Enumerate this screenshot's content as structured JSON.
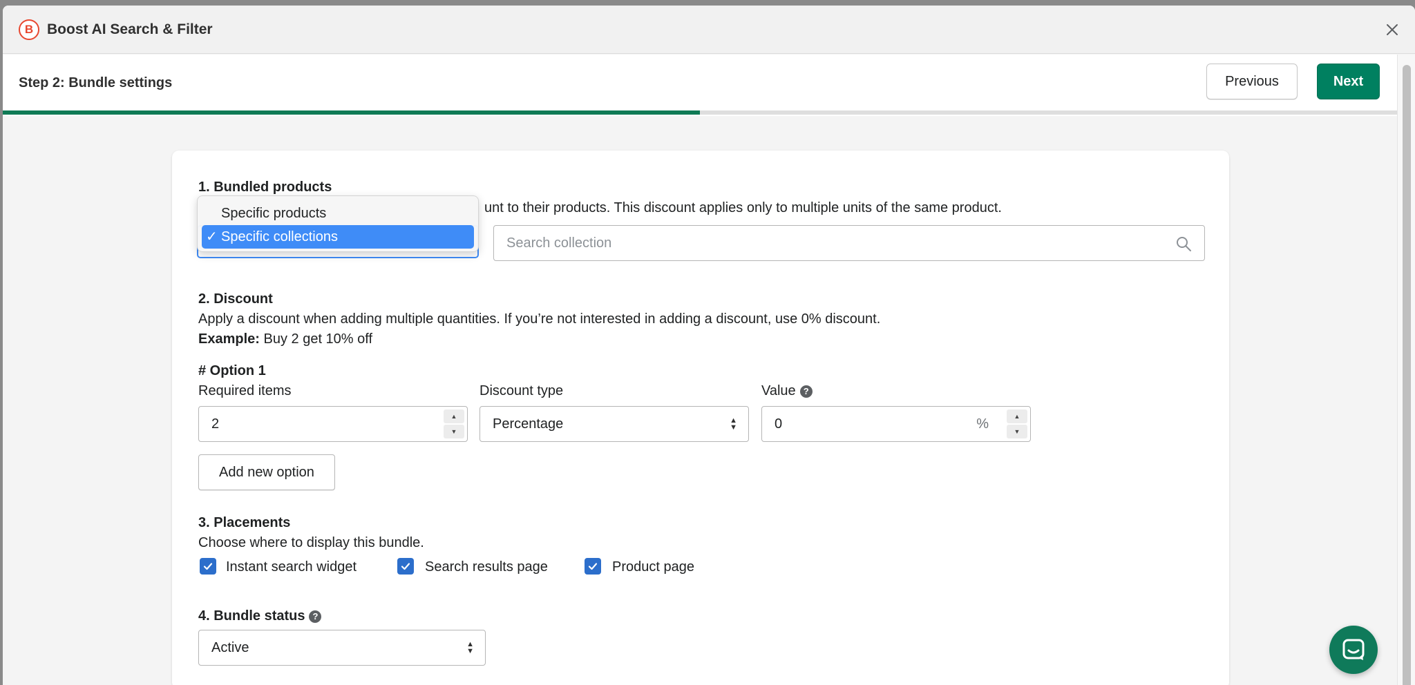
{
  "app": {
    "title": "Boost AI Search & Filter",
    "logo_letter": "B"
  },
  "header": {
    "step_title": "Step 2: Bundle settings",
    "previous_label": "Previous",
    "next_label": "Next",
    "progress_fraction": 0.5
  },
  "section1": {
    "title": "1. Bundled products",
    "description": "unt to their products. This discount applies only to multiple units of the same product.",
    "dropdown_options": [
      "Specific products",
      "Specific collections"
    ],
    "selected_option": "Specific collections",
    "checkmark": "✓",
    "search_placeholder": "Search collection"
  },
  "section2": {
    "title": "2. Discount",
    "description": "Apply a discount when adding multiple quantities. If you’re not interested in adding a discount, use 0% discount.",
    "example_label": "Example:",
    "example_text": "Buy 2 get 10% off",
    "option_title": "# Option 1",
    "required_items_label": "Required items",
    "required_items_value": "2",
    "discount_type_label": "Discount type",
    "discount_type_value": "Percentage",
    "value_label": "Value",
    "value_value": "0",
    "value_suffix": "%",
    "add_option_label": "Add new option"
  },
  "section3": {
    "title": "3. Placements",
    "description": "Choose where to display this bundle.",
    "placements": [
      {
        "label": "Instant search widget",
        "checked": true
      },
      {
        "label": "Search results page",
        "checked": true
      },
      {
        "label": "Product page",
        "checked": true
      }
    ]
  },
  "section4": {
    "title": "4. Bundle status",
    "status_value": "Active"
  },
  "icons": {
    "help": "?",
    "stepper_up": "▲",
    "stepper_down": "▼",
    "select_up": "▲",
    "select_down": "▼"
  },
  "colors": {
    "primary": "#008060",
    "checkbox": "#2c6ecb",
    "dropdown_highlight": "#3f8cf7",
    "brand": "#e8472f"
  }
}
